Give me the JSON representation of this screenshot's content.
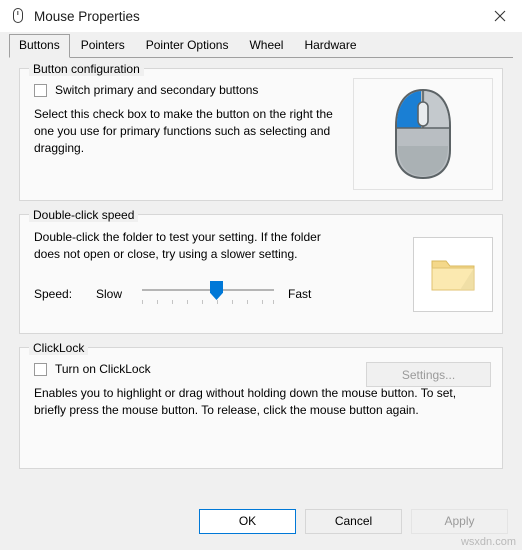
{
  "window": {
    "title": "Mouse Properties",
    "icon": "mouse-icon",
    "close_icon": "close-icon"
  },
  "tabs": [
    {
      "label": "Buttons",
      "active": true
    },
    {
      "label": "Pointers",
      "active": false
    },
    {
      "label": "Pointer Options",
      "active": false
    },
    {
      "label": "Wheel",
      "active": false
    },
    {
      "label": "Hardware",
      "active": false
    }
  ],
  "button_configuration": {
    "legend": "Button configuration",
    "checkbox_label": "Switch primary and secondary buttons",
    "checked": false,
    "description": "Select this check box to make the button on the right the one you use for primary functions such as selecting and dragging.",
    "preview_icon": "mouse-preview-image"
  },
  "double_click_speed": {
    "legend": "Double-click speed",
    "description": "Double-click the folder to test your setting. If the folder does not open or close, try using a slower setting.",
    "speed_label": "Speed:",
    "slow_label": "Slow",
    "fast_label": "Fast",
    "slider_value": 52,
    "folder_icon": "folder-preview-image"
  },
  "clicklock": {
    "legend": "ClickLock",
    "checkbox_label": "Turn on ClickLock",
    "checked": false,
    "settings_button": "Settings...",
    "settings_enabled": false,
    "description": "Enables you to highlight or drag without holding down the mouse button. To set, briefly press the mouse button. To release, click the mouse button again."
  },
  "dialog_buttons": {
    "ok": "OK",
    "cancel": "Cancel",
    "apply": "Apply",
    "apply_enabled": false
  },
  "watermark": "wsxdn.com",
  "colors": {
    "accent": "#0078d7",
    "window_bg": "#f0f0f0",
    "group_bg": "#fafafa",
    "disabled_text": "#9a9a9a"
  }
}
